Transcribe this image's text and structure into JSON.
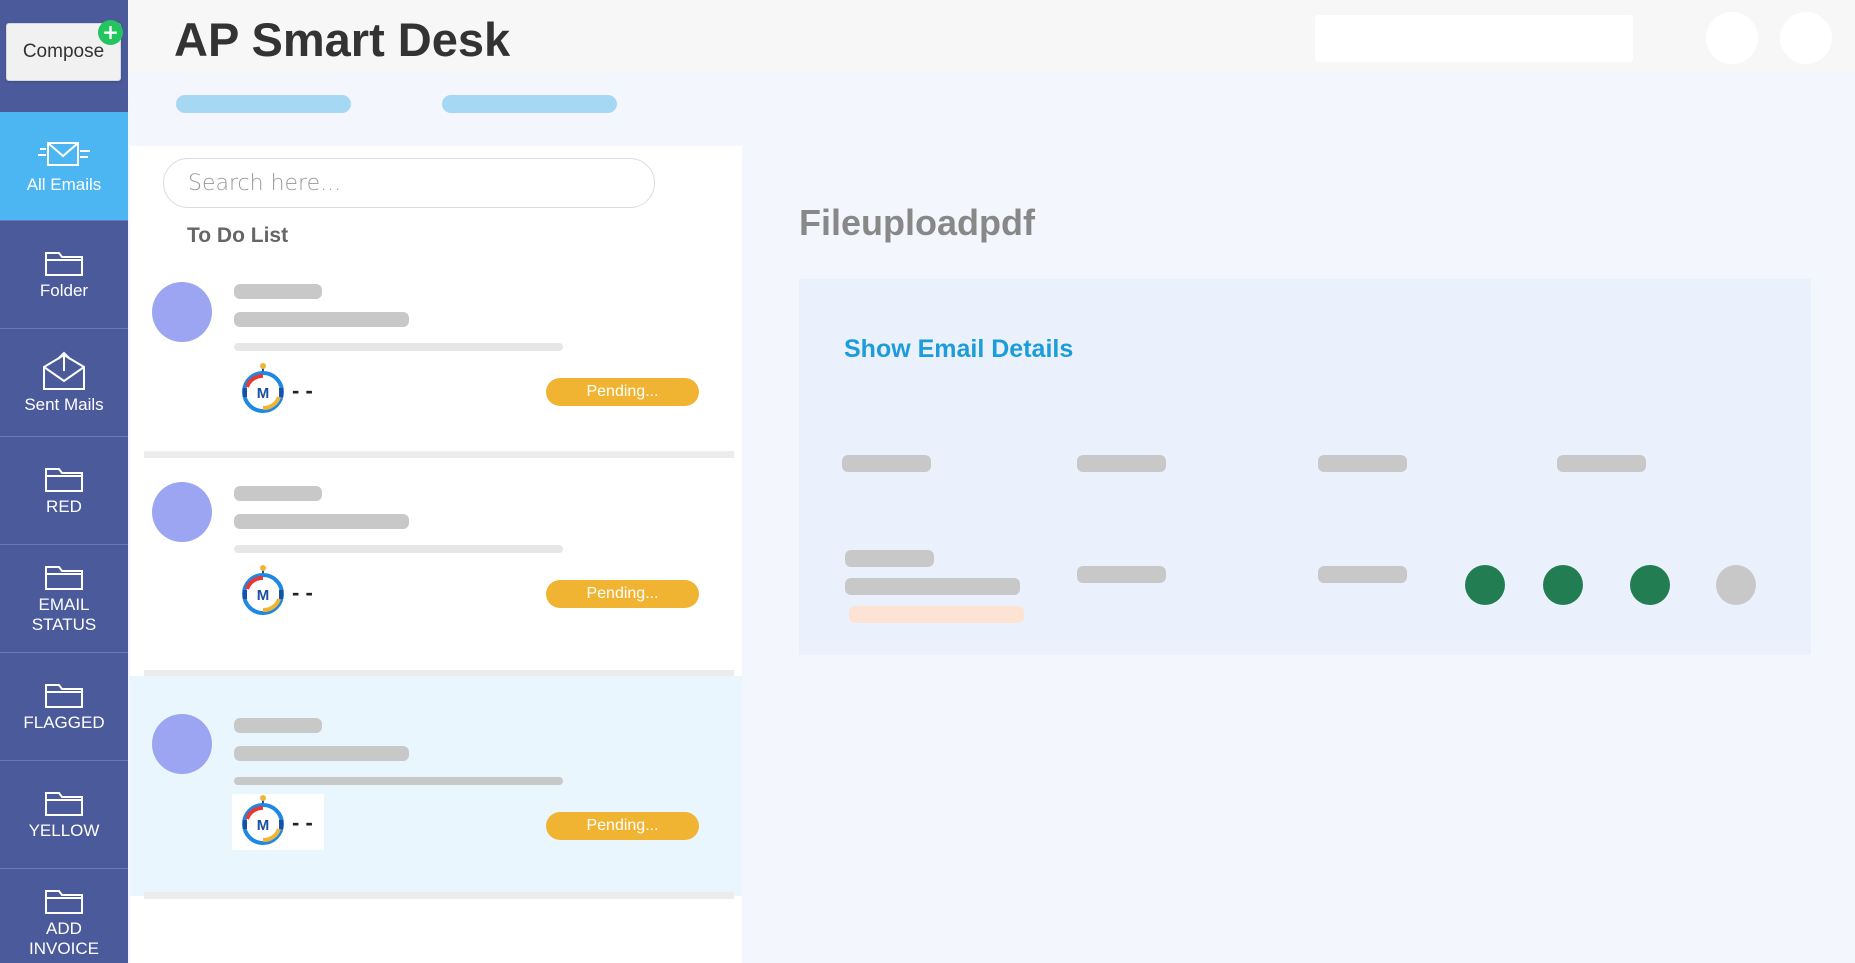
{
  "sidebar": {
    "compose_label": "Compose",
    "compose_plus": "+",
    "items": [
      {
        "label": "All Emails",
        "icon": "mail-send-icon",
        "active": true
      },
      {
        "label": "Folder",
        "icon": "folder-icon"
      },
      {
        "label": "Sent Mails",
        "icon": "envelope-upload-icon"
      },
      {
        "label": "RED",
        "icon": "folder-icon"
      },
      {
        "label": "EMAIL STATUS",
        "icon": "folder-icon"
      },
      {
        "label": "FLAGGED",
        "icon": "folder-icon"
      },
      {
        "label": "YELLOW",
        "icon": "folder-icon"
      },
      {
        "label": "ADD INVOICE",
        "icon": "folder-icon"
      }
    ]
  },
  "header": {
    "title": "AP Smart Desk"
  },
  "list": {
    "search_placeholder": "Search here...",
    "section_title": "To Do List",
    "cards": [
      {
        "sender_logo": "m-bot-logo",
        "sender_text": "- -",
        "status": "Pending..."
      },
      {
        "sender_logo": "m-bot-logo",
        "sender_text": "- -",
        "status": "Pending..."
      },
      {
        "sender_logo": "m-bot-logo",
        "sender_text": "- -",
        "status": "Pending...",
        "selected": true
      }
    ]
  },
  "detail": {
    "title": "Fileuploadpdf",
    "show_details_label": "Show Email Details",
    "status_dots": [
      "#237d52",
      "#237d52",
      "#237d52",
      "#c8c8c8"
    ]
  },
  "colors": {
    "sidebar_bg": "#4a5a9b",
    "sidebar_active": "#4bb6f2",
    "pending": "#f0b432",
    "accent_link": "#1c9cd9"
  }
}
